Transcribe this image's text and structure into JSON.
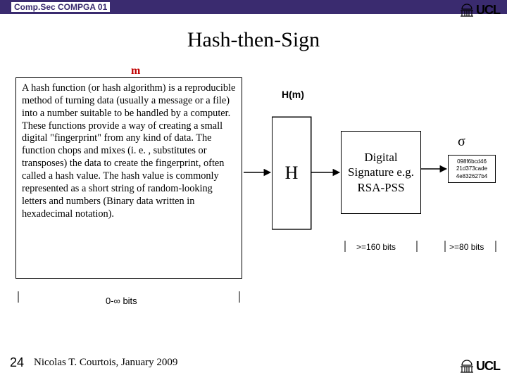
{
  "header": {
    "course_code": "Comp.Sec COMPGA 01",
    "logo_text": "UCL"
  },
  "title": "Hash-then-Sign",
  "diagram": {
    "input_label": "m",
    "message_box": "A hash function (or hash algorithm) is a reproducible method of turning data (usually a message or a file) into a number suitable to be handled by a computer. These functions provide a way of creating a small digital \"fingerprint\" from any kind of data. The function chops and mixes (i. e. , substitutes or transposes) the data to create the fingerprint, often called a hash value. The hash value is commonly represented as a short string of random-looking letters and numbers (Binary data written in hexadecimal notation).",
    "message_bits": "0-∞ bits",
    "hash_block_label": "H",
    "hash_output_label": "H(m)",
    "signature_block": "Digital Signature e.g. RSA-PSS",
    "hash_bits": ">=160 bits",
    "sigma_symbol": "σ",
    "sigma_value": "098f6bcd46 21d373cade 4e832627b4",
    "sigma_bits": ">=80 bits"
  },
  "footer": {
    "slide_number": "24",
    "author_line": "Nicolas T. Courtois, January 2009"
  }
}
